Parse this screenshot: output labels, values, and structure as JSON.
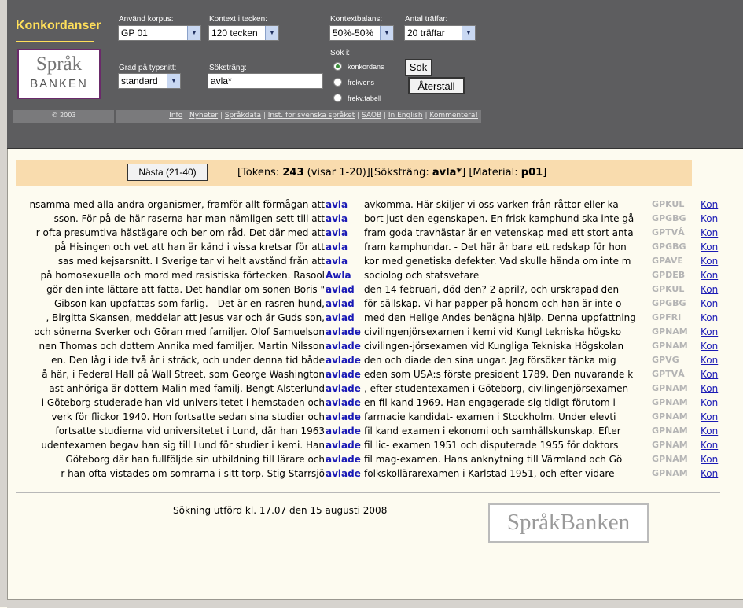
{
  "app": {
    "title": "Konkordanser",
    "logo_line1": "Språk",
    "logo_line2": "BANKEN",
    "copyright": "© 2003"
  },
  "controls": {
    "korpus_label": "Använd korpus:",
    "korpus_value": "GP 01",
    "kontext_label": "Kontext i tecken:",
    "kontext_value": "120 tecken",
    "balans_label": "Kontextbalans:",
    "balans_value": "50%-50%",
    "antal_label": "Antal träffar:",
    "antal_value": "20 träffar",
    "grad_label": "Grad på typsnitt:",
    "grad_value": "standard",
    "sok_label": "Söksträng:",
    "sok_value": "avla*",
    "sok_i_label": "Sök i:",
    "radio_options": [
      "konkordans",
      "frekvens",
      "frekv.tabell"
    ],
    "sok_button": "Sök",
    "reset_button": "Återställ"
  },
  "links": [
    "Info",
    "Nyheter",
    "Språkdata",
    "Inst. för svenska språket",
    "SAOB",
    "In English",
    "Kommentera!"
  ],
  "results": {
    "next_button": "Nästa (21-40)",
    "stats_prefix": "[Tokens: ",
    "tokens": "243",
    "stats_mid": " (visar 1-20)][Söksträng: ",
    "search": "avla*",
    "stats_mat": "] [Material: ",
    "material": "p01",
    "stats_end": "]",
    "kon_label": "Kon",
    "rows": [
      {
        "left": "nsamma med alla andra organismer, framför allt förmågan att",
        "kw": "avla",
        "right": "avkomma. Här skiljer vi oss varken från råttor eller ka",
        "src": "GPKUL"
      },
      {
        "left": "sson. För på de här raserna har man nämligen sett till att",
        "kw": "avla",
        "right": "bort just den egenskapen. En frisk kamphund ska inte gå",
        "src": "GPGBG"
      },
      {
        "left": "r ofta presumtiva hästägare och ber om råd. Det där med att",
        "kw": "avla",
        "right": "fram goda travhästar är en vetenskap med ett stort anta",
        "src": "GPTVÅ"
      },
      {
        "left": "på Hisingen och vet att han är känd i vissa kretsar för att",
        "kw": "avla",
        "right": "fram kamphundar. - Det här är bara ett redskap för hon",
        "src": "GPGBG"
      },
      {
        "left": "sas med kejsarsnitt. I Sverige tar vi helt avstånd från att",
        "kw": "avla",
        "right": "kor med genetiska defekter. Vad skulle hända om inte m",
        "src": "GPAVE"
      },
      {
        "left": "på homosexuella och mord med rasistiska förtecken. Rasool",
        "kw": "Awla",
        "right": "sociolog och statsvetare",
        "src": "GPDEB"
      },
      {
        "left": "gör den inte lättare att fatta. Det handlar om sonen Boris \"",
        "kw": "avlad",
        "right": "den 14 februari, död den? 2 april?, och urskrapad den",
        "src": "GPKUL"
      },
      {
        "left": "Gibson kan uppfattas som farlig. - Det är en rasren hund,",
        "kw": "avlad",
        "right": "för sällskap. Vi har papper på honom och han är inte o",
        "src": "GPGBG"
      },
      {
        "left": ", Birgitta Skansen, meddelar att Jesus var och är Guds son,",
        "kw": "avlad",
        "right": "med den Helige Andes benägna hjälp. Denna uppfattning",
        "src": "GPFRI"
      },
      {
        "left": "och sönerna Sverker och Göran med familjer. Olof Samuelson",
        "kw": "avlade",
        "right": "civilingenjörsexamen i kemi vid Kungl tekniska högsko",
        "src": "GPNAM"
      },
      {
        "left": "nen Thomas och dottern Annika med familjer. Martin Nilsson",
        "kw": "avlade",
        "right": "civilingen-jörsexamen vid Kungliga Tekniska Högskolan",
        "src": "GPNAM"
      },
      {
        "left": "en. Den låg i ide två år i sträck, och under denna tid både",
        "kw": "avlade",
        "right": "den och diade den sina ungar. Jag försöker tänka mig",
        "src": "GPVG"
      },
      {
        "left": "å här, i Federal Hall på Wall Street, som George Washington",
        "kw": "avlade",
        "right": "eden som USA:s förste president 1789. Den nuvarande k",
        "src": "GPTVÅ"
      },
      {
        "left": "ast anhöriga är dottern Malin med familj. Bengt Alsterlund",
        "kw": "avlade",
        "right": ", efter studentexamen i Göteborg, civilingenjörsexamen",
        "src": "GPNAM"
      },
      {
        "left": "i Göteborg studerade han vid universitetet i hemstaden och",
        "kw": "avlade",
        "right": "en fil kand 1969. Han engagerade sig tidigt förutom i",
        "src": "GPNAM"
      },
      {
        "left": "verk för flickor 1940. Hon fortsatte sedan sina studier och",
        "kw": "avlade",
        "right": "farmacie kandidat- examen i Stockholm. Under elevti",
        "src": "GPNAM"
      },
      {
        "left": "fortsatte studierna vid universitetet i Lund, där han 1963",
        "kw": "avlade",
        "right": "fil kand examen i ekonomi och samhällskunskap. Efter",
        "src": "GPNAM"
      },
      {
        "left": "udentexamen begav han sig till Lund för studier i kemi. Han",
        "kw": "avlade",
        "right": "fil lic- examen 1951 och disputerade 1955 för doktors",
        "src": "GPNAM"
      },
      {
        "left": "Göteborg där han fullföljde sin utbildning till lärare och",
        "kw": "avlade",
        "right": "fil mag-examen. Hans anknytning till Värmland och Gö",
        "src": "GPNAM"
      },
      {
        "left": "r han ofta vistades om somrarna i sitt torp. Stig Starrsjö",
        "kw": "avlade",
        "right": "folkskollärarexamen i Karlstad 1951, och efter vidare",
        "src": "GPNAM"
      }
    ]
  },
  "footer": {
    "text": "Sökning utförd kl. 17.07 den 15 augusti 2008",
    "logo": "SpråkBanken"
  }
}
